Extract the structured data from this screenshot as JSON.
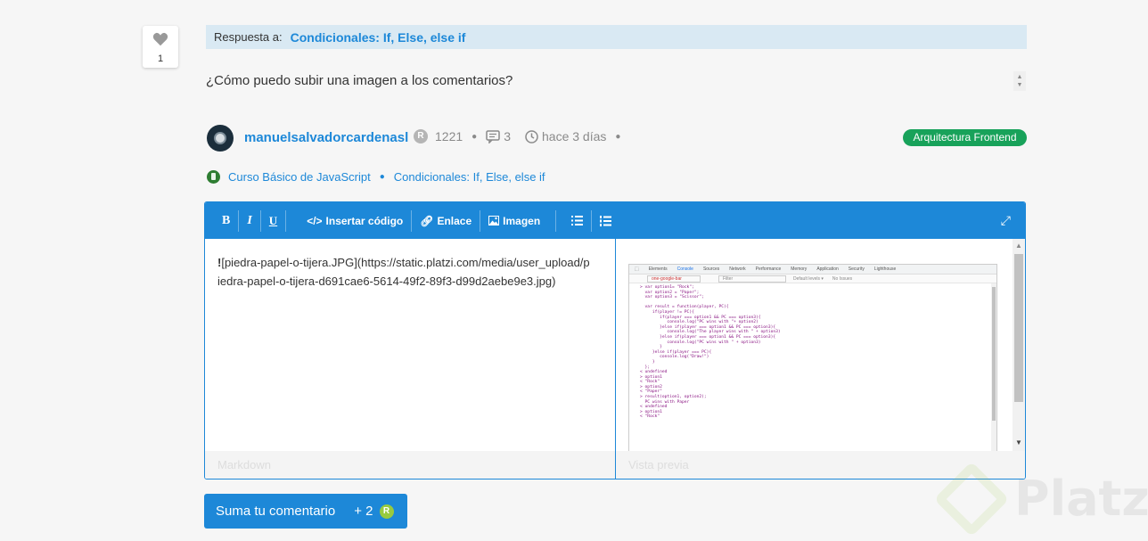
{
  "like": {
    "count": "1"
  },
  "reply": {
    "label": "Respuesta a:",
    "link": "Condicionales: If, Else, else if"
  },
  "question": "¿Cómo puedo subir una imagen a los comentarios?",
  "author": {
    "name": "manuelsalvadorcardenasl",
    "points": "1221",
    "comments": "3",
    "time": "hace 3 días",
    "badge": "Arquitectura Frontend"
  },
  "breadcrumb": {
    "course": "Curso Básico de JavaScript",
    "lesson": "Condicionales: If, Else, else if"
  },
  "toolbar": {
    "bold": "B",
    "italic": "I",
    "underline": "U",
    "code": "Insertar código",
    "link": "Enlace",
    "image": "Imagen"
  },
  "editor": {
    "bold_marker": "!",
    "markdown_text": "[piedra-papel-o-tijera.JPG](https://static.platzi.com/media/user_upload/piedra-papel-o-tijera-d691cae6-5614-49f2-89f3-d99d2aebe9e3.jpg)",
    "left_footer": "Markdown",
    "right_footer": "Vista previa"
  },
  "preview": {
    "tabs": [
      "Elements",
      "Console",
      "Sources",
      "Network",
      "Performance",
      "Memory",
      "Application",
      "Security",
      "Lighthouse"
    ],
    "active_tab": "Console",
    "context": "one-google-bar",
    "filter": "Filter",
    "levels": "Default levels ▾",
    "issues": "No Issues",
    "code": "> var option1= \"Rock\";\n  var option2 = \"Paper\";\n  var option3 = \"Scissor\";\n\n  var result = function(player, PC){\n     if(player != PC){\n        if(player === option1 && PC === option3){\n           console.log(\"PC wins with \"+ option2)\n        }else if(player === option1 && PC === option3){\n           console.log(\"The player wins with \" + option3)\n        }else if(player === option1 && PC === option3){\n           console.log(\"PC wins with \" + option3)\n        }\n     }else if(player === PC){\n        console.log(\"Draw!\")\n     }\n  };\n< undefined\n> option1\n< \"Rock\"\n> option2\n< \"Paper\"\n> result(option1, option2);\n  PC wins with Paper\n< undefined\n> option1\n< \"Rock\""
  },
  "submit": {
    "label": "Suma tu comentario",
    "points": "+ 2"
  },
  "watermark": "Platzi",
  "colors": {
    "accent": "#1d88d8",
    "badge": "#18a25a",
    "points_icon": "#98ca3f"
  }
}
